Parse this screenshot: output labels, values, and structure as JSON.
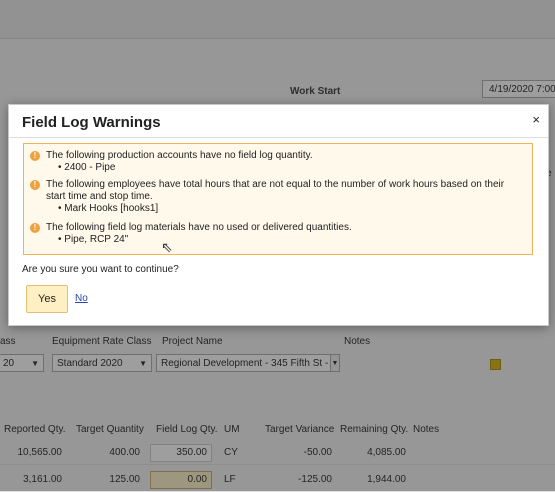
{
  "background": {
    "work_start_label": "Work Start",
    "work_start_value": "4/19/2020 7:00",
    "partial_label_e": "e",
    "equipment_headers": {
      "class": "ass",
      "equipment_rate_class": "Equipment Rate Class",
      "project_name": "Project Name",
      "notes": "Notes"
    },
    "equipment_row": {
      "class_value": "20",
      "rate_class_value": "Standard 2020",
      "project_value": "Regional Development - 345 Fifth St -"
    },
    "grid_headers": [
      "Reported Qty.",
      "Target Quantity",
      "Field Log Qty.",
      "UM",
      "Target Variance",
      "Remaining Qty.",
      "Notes"
    ],
    "grid_rows": [
      {
        "reported": "10,565.00",
        "target": "400.00",
        "field_log": "350.00",
        "um": "CY",
        "variance": "-50.00",
        "remaining": "4,085.00"
      },
      {
        "reported": "3,161.00",
        "target": "125.00",
        "field_log": "0.00",
        "um": "LF",
        "variance": "-125.00",
        "remaining": "1,944.00"
      }
    ]
  },
  "dialog": {
    "title": "Field Log Warnings",
    "close_glyph": "×",
    "warnings": [
      {
        "text": "The following production accounts have no field log quantity.",
        "items": [
          "2400 - Pipe"
        ]
      },
      {
        "text": "The following employees have total hours that are not equal to the number of work hours based on their start time and stop time.",
        "items": [
          "Mark Hooks [hooks1]"
        ]
      },
      {
        "text": "The following field log materials have no used or delivered quantities.",
        "items": [
          "Pipe, RCP 24\""
        ]
      }
    ],
    "question": "Are you sure you want to continue?",
    "yes_label": "Yes",
    "no_label": "No"
  },
  "icons": {
    "warning": "warning-circle-icon",
    "close": "close-icon"
  },
  "colors": {
    "warning_border": "#f0b35a",
    "warning_icon": "#f0a03c",
    "yes_button": "#fff0c4",
    "link": "#2a47b8"
  }
}
